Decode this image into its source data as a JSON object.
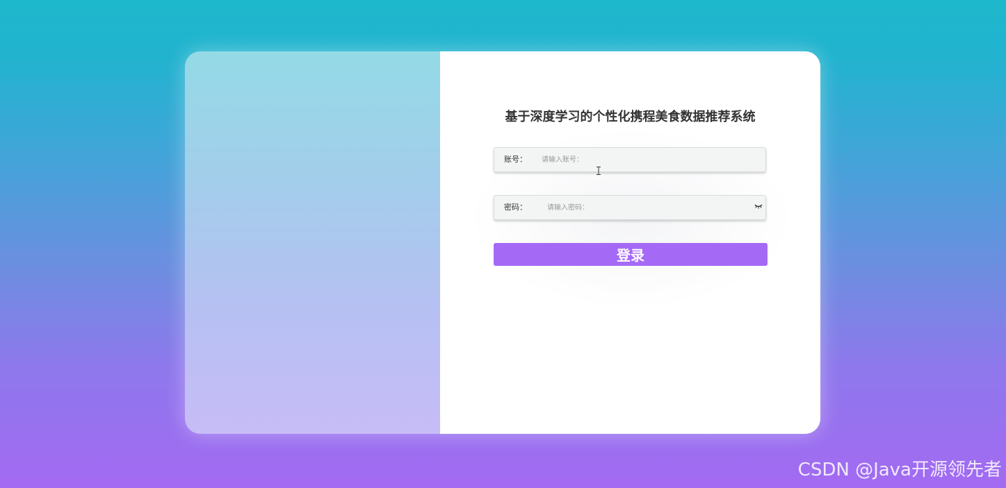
{
  "page": {
    "title": "基于深度学习的个性化携程美食数据推荐系统"
  },
  "form": {
    "account": {
      "label": "账号：",
      "placeholder": "请输入账号：",
      "value": ""
    },
    "password": {
      "label": "密码：",
      "placeholder": "请输入密码：",
      "value": "",
      "toggle_icon": "eye-closed-icon"
    },
    "login_label": "登录"
  },
  "watermark": "CSDN @Java开源领先者",
  "colors": {
    "background_top": "#1db8cc",
    "background_bottom": "#a36af2",
    "login_button": "#a56af5",
    "card": "#ffffff"
  }
}
